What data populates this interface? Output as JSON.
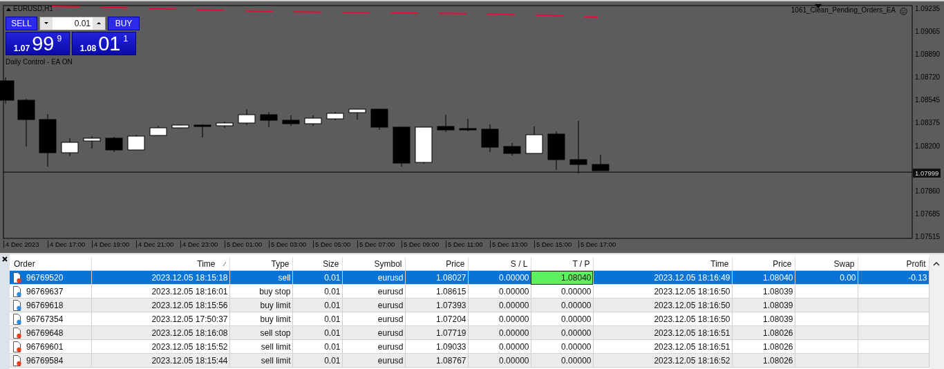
{
  "chart": {
    "title": "EURUSD,H1",
    "expert": "1061_Clean_Pending_Orders_EA",
    "status": "Daily Control - EA ON",
    "price_ticks": [
      "1.09235",
      "1.09065",
      "1.08890",
      "1.08720",
      "1.08545",
      "1.08375",
      "1.08200",
      "1.07860",
      "1.07685",
      "1.07515"
    ],
    "current_price": "1.07999",
    "time_ticks": [
      "4 Dec 2023",
      "4 Dec 17:00",
      "4 Dec 19:00",
      "4 Dec 21:00",
      "4 Dec 23:00",
      "5 Dec 01:00",
      "5 Dec 03:00",
      "5 Dec 05:00",
      "5 Dec 07:00",
      "5 Dec 09:00",
      "5 Dec 11:00",
      "5 Dec 13:00",
      "5 Dec 15:00",
      "5 Dec 17:00"
    ]
  },
  "trade_panel": {
    "sell_label": "SELL",
    "buy_label": "BUY",
    "volume": "0.01",
    "sell_quote": {
      "prefix": "1.07",
      "pips": "99",
      "fraction": "9"
    },
    "buy_quote": {
      "prefix": "1.08",
      "pips": "01",
      "fraction": "1"
    }
  },
  "table": {
    "columns": [
      {
        "label": "Order",
        "sorted": false
      },
      {
        "label": "Time",
        "sorted": true
      },
      {
        "label": "Type",
        "sorted": false
      },
      {
        "label": "Size",
        "sorted": false
      },
      {
        "label": "Symbol",
        "sorted": false
      },
      {
        "label": "Price",
        "sorted": false
      },
      {
        "label": "S / L",
        "sorted": false
      },
      {
        "label": "T / P",
        "sorted": false
      },
      {
        "label": "Time",
        "sorted": false
      },
      {
        "label": "Price",
        "sorted": false
      },
      {
        "label": "Swap",
        "sorted": false
      },
      {
        "label": "Profit",
        "sorted": false
      }
    ],
    "rows": [
      {
        "kind": "sell",
        "selected": true,
        "tp_highlight": true,
        "cells": [
          "96769520",
          "2023.12.05 18:15:18",
          "sell",
          "0.01",
          "eurusd",
          "1.08027",
          "0.00000",
          "1.08040",
          "2023.12.05 18:16:49",
          "1.08040",
          "0.00",
          "-0.13"
        ]
      },
      {
        "kind": "buy",
        "selected": false,
        "tp_highlight": false,
        "cells": [
          "96769637",
          "2023.12.05 18:16:01",
          "buy stop",
          "0.01",
          "eurusd",
          "1.08615",
          "0.00000",
          "0.00000",
          "2023.12.05 18:16:50",
          "1.08039"
        ]
      },
      {
        "kind": "buy",
        "selected": false,
        "tp_highlight": false,
        "cells": [
          "96769618",
          "2023.12.05 18:15:56",
          "buy limit",
          "0.01",
          "eurusd",
          "1.07393",
          "0.00000",
          "0.00000",
          "2023.12.05 18:16:50",
          "1.08039"
        ]
      },
      {
        "kind": "buy",
        "selected": false,
        "tp_highlight": false,
        "cells": [
          "96767354",
          "2023.12.05 17:50:37",
          "buy limit",
          "0.01",
          "eurusd",
          "1.07204",
          "0.00000",
          "0.00000",
          "2023.12.05 18:16:50",
          "1.08039"
        ]
      },
      {
        "kind": "sell",
        "selected": false,
        "tp_highlight": false,
        "cells": [
          "96769648",
          "2023.12.05 18:16:08",
          "sell stop",
          "0.01",
          "eurusd",
          "1.07719",
          "0.00000",
          "0.00000",
          "2023.12.05 18:16:51",
          "1.08026"
        ]
      },
      {
        "kind": "sell",
        "selected": false,
        "tp_highlight": false,
        "cells": [
          "96769601",
          "2023.12.05 18:15:52",
          "sell limit",
          "0.01",
          "eurusd",
          "1.09033",
          "0.00000",
          "0.00000",
          "2023.12.05 18:16:51",
          "1.08026"
        ]
      },
      {
        "kind": "sell",
        "selected": false,
        "tp_highlight": false,
        "cells": [
          "96769584",
          "2023.12.05 18:15:44",
          "sell limit",
          "0.01",
          "eurusd",
          "1.08767",
          "0.00000",
          "0.00000",
          "2023.12.05 18:16:52",
          "1.08026"
        ]
      }
    ]
  }
}
